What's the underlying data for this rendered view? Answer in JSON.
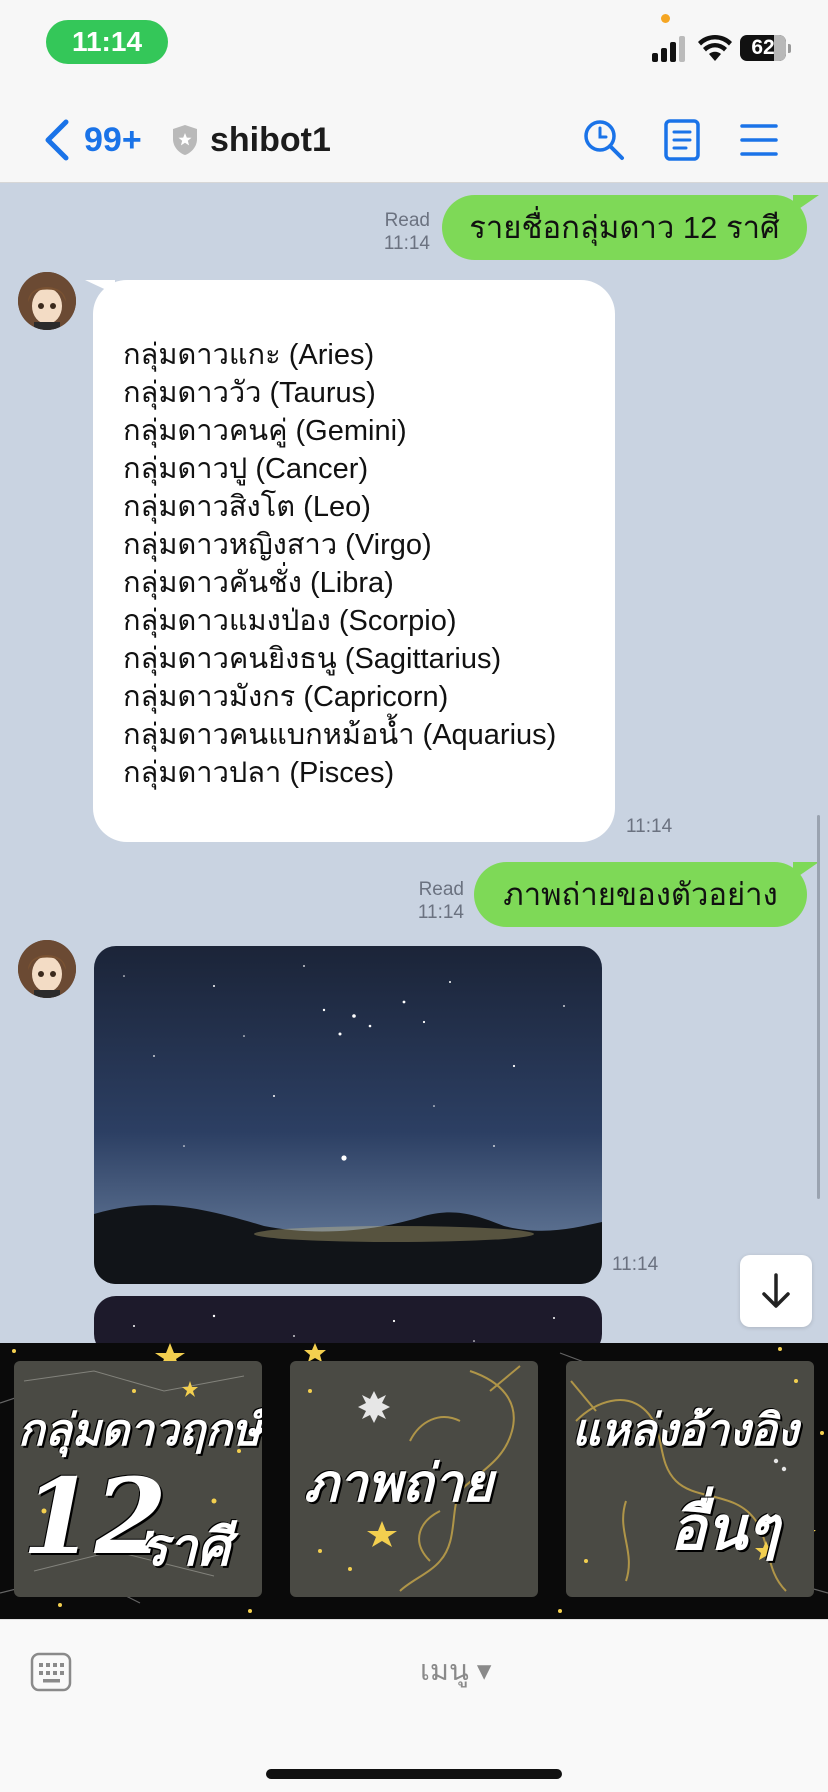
{
  "status_bar": {
    "time": "11:14",
    "battery": "62"
  },
  "header": {
    "unread_count": "99+",
    "title": "shibot1"
  },
  "messages": {
    "m1": {
      "read_label": "Read",
      "time": "11:14",
      "text": "รายชื่อกลุ่มดาว 12 ราศี"
    },
    "m2": {
      "time": "11:14",
      "lines": [
        "กลุ่มดาวแกะ (Aries)",
        "กลุ่มดาววัว (Taurus)",
        "กลุ่มดาวคนคู่ (Gemini)",
        "กลุ่มดาวปู (Cancer)",
        "กลุ่มดาวสิงโต (Leo)",
        "กลุ่มดาวหญิงสาว (Virgo)",
        "กลุ่มดาวคันชั่ง (Libra)",
        "กลุ่มดาวแมงป่อง (Scorpio)",
        "กลุ่มดาวคนยิงธนู (Sagittarius)",
        "กลุ่มดาวมังกร (Capricorn)",
        "กลุ่มดาวคนแบกหม้อน้ำ (Aquarius)",
        "กลุ่มดาวปลา (Pisces)"
      ]
    },
    "m3": {
      "read_label": "Read",
      "time": "11:14",
      "text": "ภาพถ่ายของตัวอย่าง"
    },
    "m4": {
      "time": "11:14"
    }
  },
  "rich_menu": {
    "tile1": {
      "line1": "กลุ่มดาวฤกษ์",
      "big": "12",
      "line2": "ราศี"
    },
    "tile2": {
      "line1": "ภาพถ่าย"
    },
    "tile3": {
      "line1": "แหล่งอ้างอิง",
      "line2": "อื่นๆ"
    }
  },
  "bottom_bar": {
    "menu_label": "เมนู ▾"
  },
  "icons": {
    "back": "chevron-left-icon",
    "shield": "shield-star-icon",
    "search": "search-icon",
    "notes": "notes-icon",
    "menu": "hamburger-menu-icon",
    "scroll_down": "arrow-down-icon",
    "keyboard": "keyboard-icon"
  },
  "colors": {
    "accent": "#1a73e8",
    "my_bubble": "#7ed957",
    "chat_background": "#c9d3e1",
    "time_pill": "#34c759"
  }
}
